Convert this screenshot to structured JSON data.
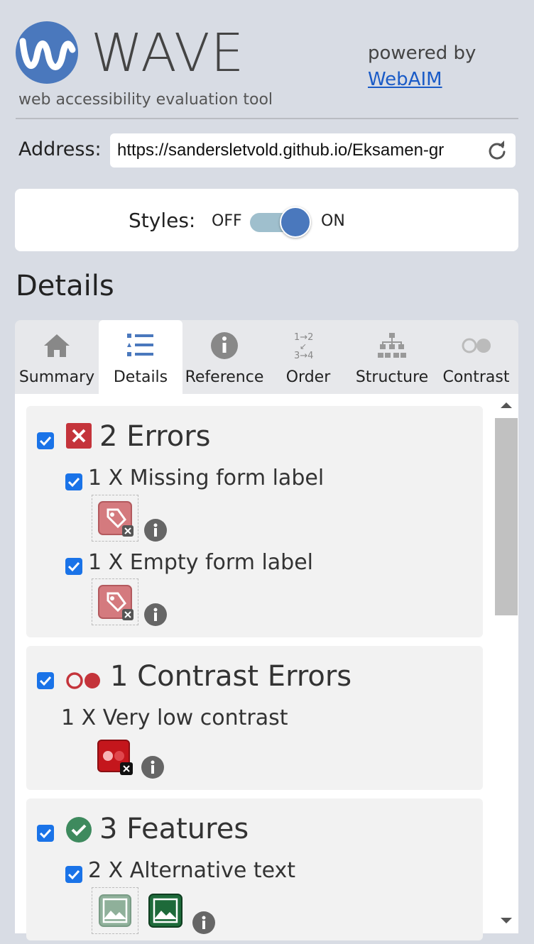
{
  "header": {
    "title": "WAVE",
    "tagline": "web accessibility evaluation tool",
    "powered_by": "powered by",
    "webaim_link": "WebAIM"
  },
  "address": {
    "label": "Address:",
    "value": "https://sandersletvold.github.io/Eksamen-gr"
  },
  "styles": {
    "label": "Styles:",
    "off": "OFF",
    "on": "ON",
    "state": "ON"
  },
  "details_heading": "Details",
  "tabs": [
    {
      "label": "Summary",
      "icon": "home-icon"
    },
    {
      "label": "Details",
      "icon": "list-icon",
      "active": true
    },
    {
      "label": "Reference",
      "icon": "info-icon"
    },
    {
      "label": "Order",
      "icon": "order-icon"
    },
    {
      "label": "Structure",
      "icon": "structure-icon"
    },
    {
      "label": "Contrast",
      "icon": "contrast-icon"
    }
  ],
  "groups": {
    "errors": {
      "title": "2 Errors",
      "items": [
        {
          "label": "1 X Missing form label"
        },
        {
          "label": "1 X Empty form label"
        }
      ]
    },
    "contrast": {
      "title": "1 Contrast Errors",
      "items": [
        {
          "label": "1 X Very low contrast"
        }
      ]
    },
    "features": {
      "title": "3 Features",
      "items": [
        {
          "label": "2 X Alternative text"
        }
      ]
    }
  },
  "colors": {
    "brand_blue": "#4a78bd",
    "error_red": "#c4343b",
    "feature_green": "#3e8a5e",
    "checkbox_blue": "#1a73e8"
  }
}
